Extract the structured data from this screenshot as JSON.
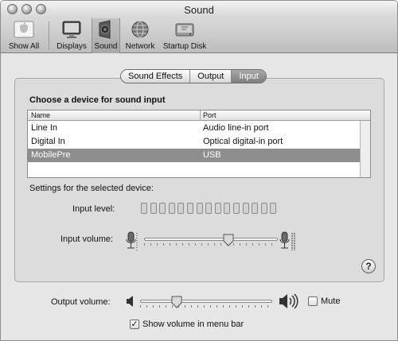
{
  "window": {
    "title": "Sound"
  },
  "toolbar": {
    "items": [
      {
        "label": "Show All",
        "icon": "apple-icon"
      },
      {
        "label": "Displays",
        "icon": "display-icon"
      },
      {
        "label": "Sound",
        "icon": "speaker-icon"
      },
      {
        "label": "Network",
        "icon": "network-globe-icon"
      },
      {
        "label": "Startup Disk",
        "icon": "hard-disk-icon"
      }
    ],
    "selected": "Sound"
  },
  "tabs": [
    {
      "label": "Sound Effects"
    },
    {
      "label": "Output"
    },
    {
      "label": "Input"
    }
  ],
  "active_tab": "Input",
  "input": {
    "heading": "Choose a device for sound input",
    "table": {
      "columns": [
        "Name",
        "Port"
      ],
      "rows": [
        {
          "name": "Line In",
          "port": "Audio line-in port"
        },
        {
          "name": "Digital In",
          "port": "Optical digital-in port"
        },
        {
          "name": "MobilePre",
          "port": "USB"
        }
      ],
      "selected_row": 2
    },
    "settings_label": "Settings for the selected device:",
    "input_level_label": "Input level:",
    "input_level_segments": 15,
    "input_level_value": 0,
    "input_volume_label": "Input volume:",
    "input_volume_value": 0.63
  },
  "output": {
    "output_volume_label": "Output volume:",
    "output_volume_value": 0.28,
    "mute_label": "Mute",
    "mute_checked": false,
    "show_volume_label": "Show volume in menu bar",
    "show_volume_checked": true,
    "check_mark": "✓"
  },
  "help_label": "?"
}
